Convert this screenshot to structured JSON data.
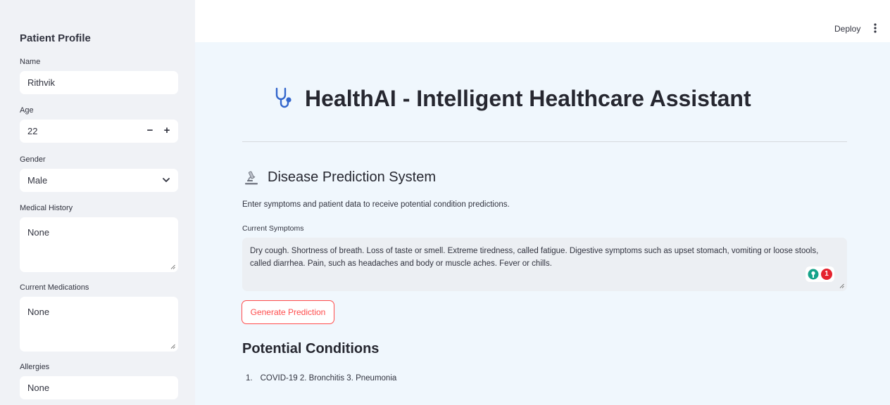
{
  "sidebar": {
    "title": "Patient Profile",
    "name": {
      "label": "Name",
      "value": "Rithvik"
    },
    "age": {
      "label": "Age",
      "value": "22",
      "decrement": "−",
      "increment": "+"
    },
    "gender": {
      "label": "Gender",
      "value": "Male"
    },
    "medical_history": {
      "label": "Medical History",
      "value": "None"
    },
    "current_medications": {
      "label": "Current Medications",
      "value": "None"
    },
    "allergies": {
      "label": "Allergies",
      "value": "None"
    }
  },
  "header": {
    "deploy_label": "Deploy"
  },
  "main": {
    "title": "HealthAI - Intelligent Healthcare Assistant",
    "section_title": "Disease Prediction System",
    "section_description": "Enter symptoms and patient data to receive potential condition predictions.",
    "symptoms_label": "Current Symptoms",
    "symptoms_value": "Dry cough. Shortness of breath. Loss of taste or smell. Extreme tiredness, called fatigue. Digestive symptoms such as upset stomach, vomiting or loose stools, called diarrhea. Pain, such as headaches and body or muscle aches. Fever or chills.",
    "grammar_count": "1",
    "generate_button": "Generate Prediction",
    "results_title": "Potential Conditions",
    "results_number": "1.",
    "results_text": "COVID-19 2. Bronchitis 3. Pneumonia"
  },
  "colors": {
    "accent": "#ff4b4b",
    "sidebar_bg": "#f0f2f6",
    "main_bg": "#f0f7fd",
    "icon_blue": "#3366cc"
  },
  "icons": {
    "title": "stethoscope-icon",
    "section": "microscope-icon",
    "gender_dropdown": "chevron-down-icon",
    "menu": "kebab-menu-icon",
    "grammar": "grammar-assistant-icon"
  }
}
